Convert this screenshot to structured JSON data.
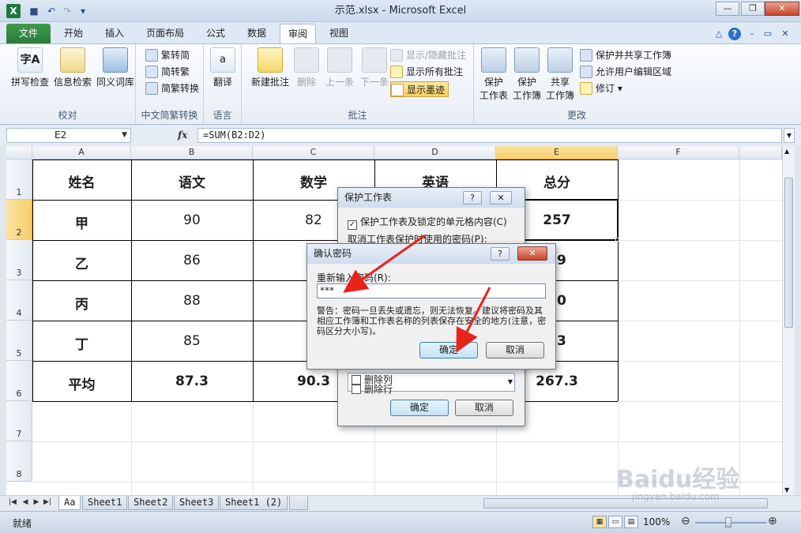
{
  "window": {
    "title": "示范.xlsx - Microsoft Excel",
    "app_icon": "X",
    "minimize": "—",
    "restore": "❐",
    "close": "✕"
  },
  "quick_access": {
    "save": "■",
    "undo": "↶",
    "redo": "↷",
    "customize": "▾"
  },
  "tabs": [
    "文件",
    "开始",
    "插入",
    "页面布局",
    "公式",
    "数据",
    "审阅",
    "视图"
  ],
  "active_tab": "审阅",
  "ribbon": {
    "groups": {
      "proofing": {
        "label": "校对",
        "buttons": [
          "拼写检查",
          "信息检索",
          "同义词库"
        ]
      },
      "chinese": {
        "label": "中文简繁转换",
        "buttons": [
          "繁转简",
          "简转繁",
          "简繁转换"
        ]
      },
      "language": {
        "label": "语言",
        "buttons": [
          "翻译"
        ]
      },
      "comments": {
        "label": "批注",
        "buttons": [
          "新建批注",
          "删除",
          "上一条",
          "下一条"
        ],
        "small": [
          "显示/隐藏批注",
          "显示所有批注",
          "显示墨迹"
        ]
      },
      "changes": {
        "label": "更改",
        "big": [
          "保护\n工作表",
          "保护\n工作簿",
          "共享\n工作簿"
        ],
        "big_lines": [
          [
            "保护",
            "工作表"
          ],
          [
            "保护",
            "工作簿"
          ],
          [
            "共享",
            "工作簿"
          ]
        ],
        "small": [
          "保护并共享工作簿",
          "允许用户编辑区域",
          "修订 ▾"
        ]
      }
    }
  },
  "formula_bar": {
    "name_box": "E2",
    "fx": "fx",
    "formula": "=SUM(B2:D2)"
  },
  "columns": [
    "A",
    "B",
    "C",
    "D",
    "E",
    "F"
  ],
  "rows": [
    "1",
    "2",
    "3",
    "4",
    "5",
    "6",
    "7",
    "8"
  ],
  "table": {
    "header": [
      "姓名",
      "语文",
      "数学",
      "英语",
      "总分"
    ],
    "rows": [
      [
        "甲",
        "90",
        "82",
        "",
        "257"
      ],
      [
        "乙",
        "86",
        "",
        "",
        "79"
      ],
      [
        "丙",
        "88",
        "",
        "",
        "70"
      ],
      [
        "丁",
        "85",
        "",
        "",
        "63"
      ],
      [
        "平均",
        "87.3",
        "90.3",
        "",
        "267.3"
      ]
    ]
  },
  "sheet_tabs": [
    "Aa",
    "Sheet1",
    "Sheet2",
    "Sheet3",
    "Sheet1 (2)"
  ],
  "status": {
    "ready": "就绪",
    "zoom": "100%"
  },
  "protect_dialog": {
    "title": "保护工作表",
    "checkbox_label": "保护工作表及锁定的单元格内容(C)",
    "password_label": "取消工作表保护时使用的密码(P):",
    "list_items": [
      "删除列",
      "删除行"
    ],
    "ok": "确定",
    "cancel": "取消"
  },
  "confirm_dialog": {
    "title": "确认密码",
    "prompt": "重新输入密码(R):",
    "password": "***",
    "warning": "警告：密码一旦丢失或遗忘，则无法恢复。建议将密码及其相应工作簿和工作表名称的列表保存在安全的地方(注意，密码区分大小写)。",
    "ok": "确定",
    "cancel": "取消"
  },
  "watermark": {
    "text": "Baidu经验",
    "sub": "jingyan.baidu.com"
  }
}
